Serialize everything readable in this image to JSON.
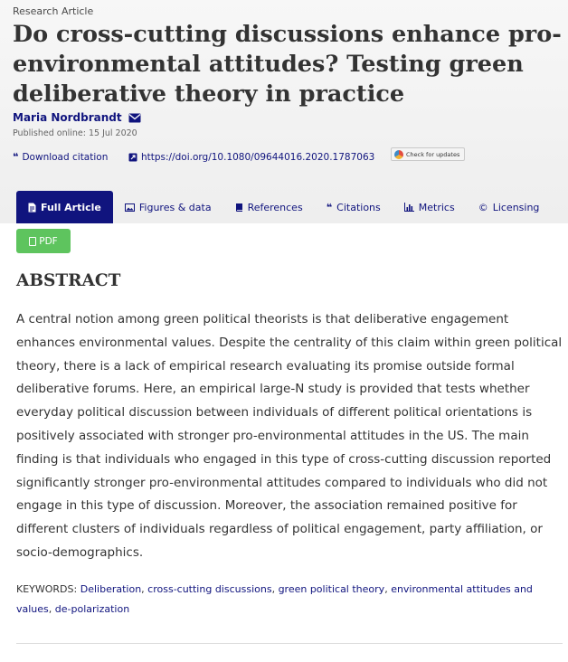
{
  "article": {
    "type": "Research Article",
    "title": "Do cross-cutting discussions enhance pro-environmental attitudes? Testing green deliberative theory in practice",
    "author": "Maria Nordbrandt",
    "published": "Published online: 15 Jul 2020"
  },
  "actions": {
    "download_citation": "Download citation",
    "doi": "https://doi.org/10.1080/09644016.2020.1787063",
    "check_updates": "Check for updates"
  },
  "tabs": [
    {
      "label": "Full Article",
      "icon": "document-icon",
      "active": true
    },
    {
      "label": "Figures & data",
      "icon": "image-icon",
      "active": false
    },
    {
      "label": "References",
      "icon": "book-icon",
      "active": false
    },
    {
      "label": "Citations",
      "icon": "quote-icon",
      "active": false
    },
    {
      "label": "Metrics",
      "icon": "bar-chart-icon",
      "active": false
    },
    {
      "label": "Licensing",
      "icon": "copyright-icon",
      "active": false
    }
  ],
  "pdf_button": "PDF",
  "abstract": {
    "heading": "ABSTRACT",
    "text": "A central notion among green political theorists is that deliberative engagement enhances environmental values. Despite the centrality of this claim within green political theory, there is a lack of empirical research evaluating its promise outside formal deliberative forums. Here, an empirical large-N study is provided that tests whether everyday political discussion between individuals of different political orientations is positively associated with stronger pro-environmental attitudes in the US. The main finding is that individuals who engaged in this type of cross-cutting discussion reported significantly stronger pro-environmental attitudes compared to individuals who did not engage in this type of discussion. Moreover, the association remained positive for different clusters of individuals regardless of political engagement, party affiliation, or socio-demographics."
  },
  "keywords": {
    "label": "KEYWORDS:",
    "items": [
      "Deliberation",
      "cross-cutting discussions",
      "green political theory",
      "environmental attitudes and values",
      "de-polarization"
    ]
  },
  "colors": {
    "brand_navy": "#10147e",
    "pdf_green": "#5ec45e",
    "header_bg": "#eeeeee"
  }
}
